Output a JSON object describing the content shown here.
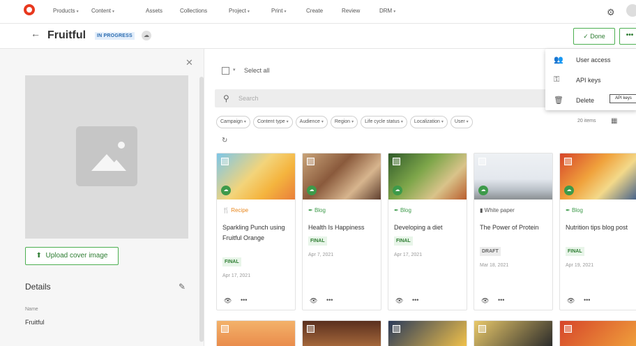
{
  "nav": {
    "items": [
      {
        "label": "Products",
        "caret": true
      },
      {
        "label": "Content",
        "caret": true
      },
      {
        "label": "Assets",
        "caret": false
      },
      {
        "label": "Collections",
        "caret": false
      },
      {
        "label": "Project",
        "caret": true
      },
      {
        "label": "Print",
        "caret": true
      },
      {
        "label": "Create",
        "caret": false
      },
      {
        "label": "Review",
        "caret": false
      },
      {
        "label": "DRM",
        "caret": true
      }
    ]
  },
  "header": {
    "back": "←",
    "title": "Fruitful",
    "status": "IN PROGRESS",
    "done_label": "Done",
    "done_icon": "✓",
    "more_label": "•••"
  },
  "left": {
    "close": "✕",
    "upload_label": "Upload cover image",
    "upload_icon": "⬆",
    "details_title": "Details",
    "name_label": "Name",
    "name_value": "Fruitful"
  },
  "main": {
    "select_all": "Select all",
    "search_placeholder": "Search",
    "filters": [
      "Campaign",
      "Content type",
      "Audience",
      "Region",
      "Life cycle status",
      "Localization",
      "User"
    ],
    "items_count": "20 items"
  },
  "cards": [
    {
      "type": "Recipe",
      "type_icon": "🍴",
      "type_color": "#e8871e",
      "title": "Sparkling Punch using Fruitful Orange",
      "status": "FINAL",
      "status_kind": "final",
      "date": "Apr 17, 2021",
      "thumb": "linear-gradient(135deg,#7cc6e8 0%,#f3d47a 45%,#f4b43e 70%,#e97c3a 100%)"
    },
    {
      "type": "Blog",
      "type_icon": "✒",
      "type_color": "#3d9a4a",
      "title": "Health Is Happiness",
      "status": "FINAL",
      "status_kind": "final",
      "date": "Apr 7, 2021",
      "thumb": "linear-gradient(135deg,#c9a47a 0%,#8a5a3c 40%,#d7b58e 70%,#5a3a2a 100%)"
    },
    {
      "type": "Blog",
      "type_icon": "✒",
      "type_color": "#3d9a4a",
      "title": "Developing a diet",
      "status": "FINAL",
      "status_kind": "final",
      "date": "Apr 17, 2021",
      "thumb": "linear-gradient(135deg,#2f5a2a 0%,#7ea64a 40%,#d9c38a 70%,#b85a2a 100%)"
    },
    {
      "type": "White paper",
      "type_icon": "▮",
      "type_color": "#555555",
      "title": "The Power of Protein",
      "status": "DRAFT",
      "status_kind": "draft",
      "date": "Mar 18, 2021",
      "thumb": "linear-gradient(180deg,#eef1f4 0%,#e4e8ee 55%,#b8bfc6 80%,#8a8f92 100%)"
    },
    {
      "type": "Blog",
      "type_icon": "✒",
      "type_color": "#3d9a4a",
      "title": "Nutrition tips blog post",
      "status": "FINAL",
      "status_kind": "final",
      "date": "Apr 19, 2021",
      "thumb": "linear-gradient(135deg,#d6452a 0%,#f0a23c 40%,#f3d98a 65%,#3a5a8a 100%)"
    }
  ],
  "bottom_cards": [
    {
      "thumb": "linear-gradient(180deg,#f3b26a 0%,#e98a4a 100%)"
    },
    {
      "thumb": "linear-gradient(180deg,#5a2f1e 0%,#a86a3c 100%)"
    },
    {
      "thumb": "linear-gradient(135deg,#2a3a5a 0%,#f2c24a 100%)"
    },
    {
      "thumb": "linear-gradient(135deg,#e8c86a 0%,#2a2a2a 100%)"
    },
    {
      "thumb": "linear-gradient(135deg,#d6452a 0%,#f0a23c 100%)"
    }
  ],
  "menu": {
    "items": [
      {
        "label": "User access",
        "icon": "👥"
      },
      {
        "label": "API keys",
        "icon": "⚿"
      },
      {
        "label": "Delete",
        "icon": "🗑"
      }
    ],
    "tooltip": "API keys"
  }
}
